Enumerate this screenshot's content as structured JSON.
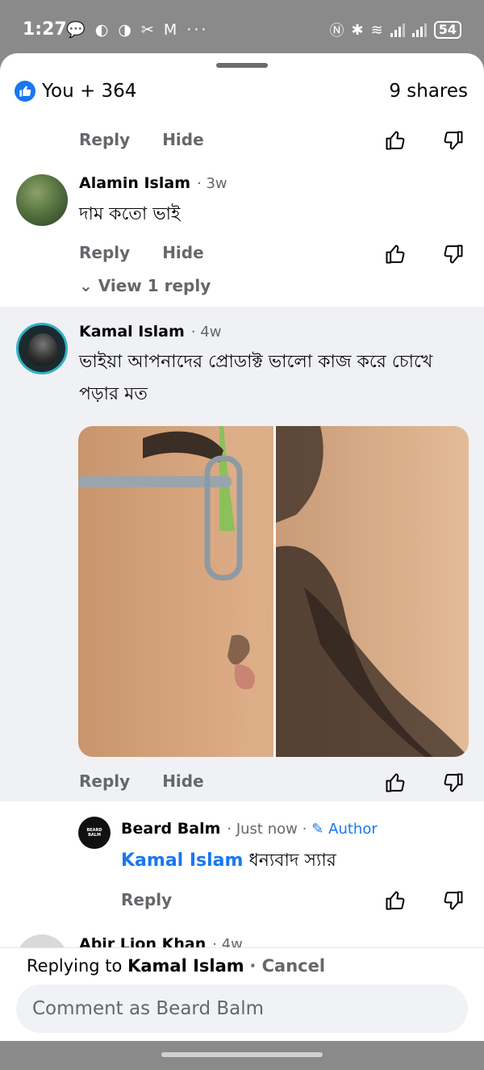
{
  "status_bar": {
    "time": "1:27",
    "left_icons": "💬 ◐ ◑ ✂ M ···",
    "battery": "54"
  },
  "header": {
    "reactions": "You + 364",
    "shares": "9 shares"
  },
  "action_labels": {
    "reply": "Reply",
    "hide": "Hide"
  },
  "comments": [
    {
      "name": "Alamin Islam",
      "time": "· 3w",
      "text": "দাম কতো ভাই",
      "view_replies": "View 1 reply"
    },
    {
      "name": "Kamal Islam",
      "time": "· 4w",
      "text": "ভাইয়া আপনাদের প্রোডাক্ট ভালো কাজ করে চোখে পড়ার মত"
    }
  ],
  "reply": {
    "name": "Beard Balm",
    "time": "· Just now ·",
    "author_badge": "Author",
    "mention": "Kamal Islam",
    "text": "ধন্যবাদ স্যার",
    "avatar_text": "BEARD BALM"
  },
  "partial_comment": {
    "name": "Abir Lion Khan",
    "time": "· 4w"
  },
  "composer": {
    "replying_prefix": "Replying to",
    "replying_name": "Kamal Islam",
    "cancel": "· Cancel",
    "placeholder": "Comment as Beard Balm"
  },
  "colors": {
    "accent": "#1877f2",
    "secondary_text": "#65676b",
    "highlight_bg": "#f0f1f5"
  }
}
